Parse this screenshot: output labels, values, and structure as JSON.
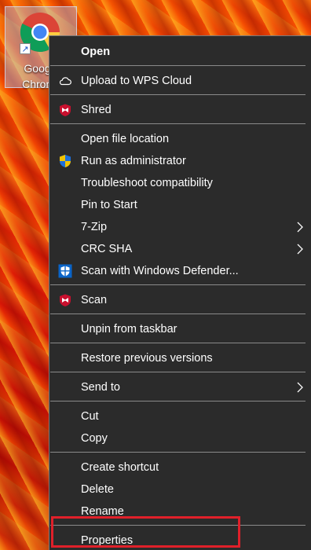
{
  "desktop_icon": {
    "label": "Google\nChrome",
    "icon": "chrome-icon"
  },
  "context_menu": {
    "items": [
      {
        "label": "Open",
        "bold": true,
        "icon": ""
      },
      {
        "label": "Upload to WPS Cloud",
        "icon": "cloud-icon"
      },
      {
        "label": "Shred",
        "icon": "mcafee-icon"
      },
      {
        "label": "Open file location",
        "icon": ""
      },
      {
        "label": "Run as administrator",
        "icon": "uac-shield-icon"
      },
      {
        "label": "Troubleshoot compatibility",
        "icon": ""
      },
      {
        "label": "Pin to Start",
        "icon": ""
      },
      {
        "label": "7-Zip",
        "icon": "",
        "submenu": true
      },
      {
        "label": "CRC SHA",
        "icon": "",
        "submenu": true
      },
      {
        "label": "Scan with Windows Defender...",
        "icon": "defender-icon"
      },
      {
        "label": "Scan",
        "icon": "mcafee-icon"
      },
      {
        "label": "Unpin from taskbar",
        "icon": ""
      },
      {
        "label": "Restore previous versions",
        "icon": ""
      },
      {
        "label": "Send to",
        "icon": "",
        "submenu": true
      },
      {
        "label": "Cut",
        "icon": ""
      },
      {
        "label": "Copy",
        "icon": ""
      },
      {
        "label": "Create shortcut",
        "icon": ""
      },
      {
        "label": "Delete",
        "icon": ""
      },
      {
        "label": "Rename",
        "icon": ""
      },
      {
        "label": "Properties",
        "icon": "",
        "highlighted": true
      }
    ]
  },
  "colors": {
    "menu_bg": "#2b2b2b",
    "highlight": "#e0202a",
    "mcafee_red": "#c8102e",
    "defender_blue": "#0a64c8"
  }
}
